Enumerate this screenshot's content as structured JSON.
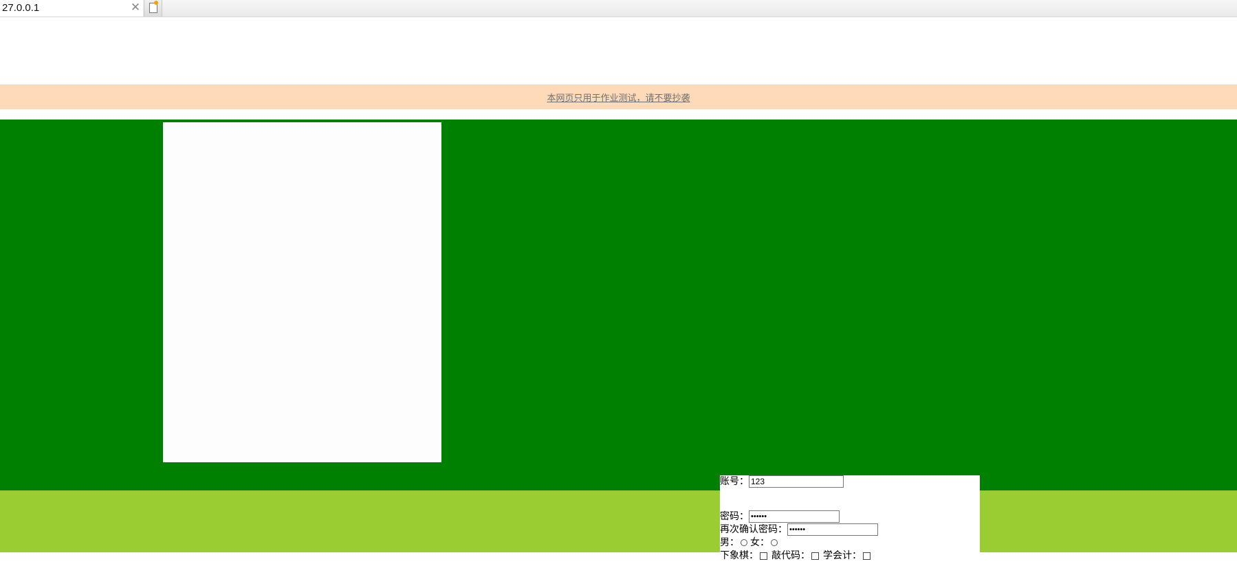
{
  "browser": {
    "tab_title": "27.0.0.1",
    "close_symbol": "✕",
    "new_tab_icon": "new-tab-icon"
  },
  "notice": {
    "text": "本网页只用于作业测试，请不要抄袭"
  },
  "colors": {
    "notice_bg": "#ffdab9",
    "main_band": "#008000",
    "footer_band": "#9acd32",
    "panel": "#fdfdfd"
  },
  "form": {
    "account_label": "账号：",
    "account_value": "123",
    "password_label": "密码：",
    "password_value": "123456",
    "confirm_label": "再次确认密码：",
    "confirm_value": "123456",
    "male_label": "男：",
    "female_label": "女：",
    "hobby_chess_label": "下象棋：",
    "hobby_code_label": "敲代码：",
    "hobby_accounting_label": "学会计："
  }
}
